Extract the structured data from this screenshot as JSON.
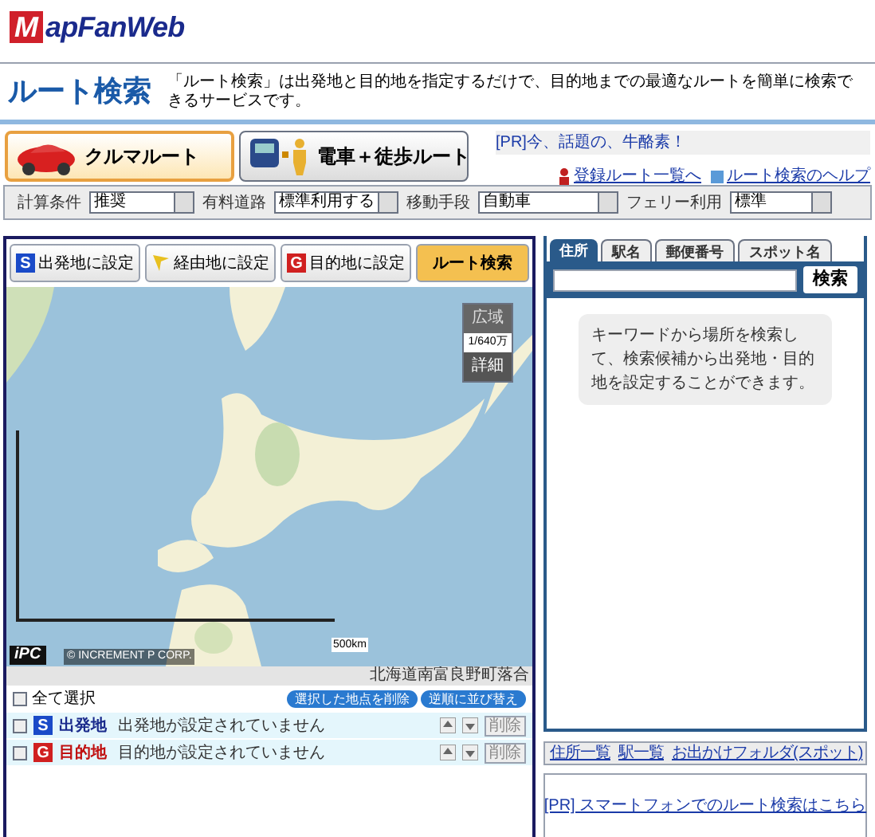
{
  "header": {
    "logo": "MapFanWeb"
  },
  "title": "ルート検索",
  "description": "「ルート検索」は出発地と目的地を指定するだけで、目的地までの最適なルートを簡単に検索できるサービスです。",
  "mode_tabs": [
    {
      "kind": "car",
      "label": "クルマルート",
      "selected": true
    },
    {
      "kind": "train",
      "label": "電車＋徒歩ルート",
      "selected": false
    }
  ],
  "pr_text": "[PR]今、話題の、牛酪素！",
  "links": [
    {
      "kind": "person",
      "label": "登録ルート一覧へ"
    },
    {
      "kind": "square",
      "label": "ルート検索のヘルプ"
    }
  ],
  "conditions": [
    {
      "label": "計算条件",
      "value": "推奨"
    },
    {
      "label": "有料道路",
      "value": "標準利用する"
    },
    {
      "label": "移動手段",
      "value": "自動車"
    },
    {
      "label": "フェリー利用",
      "value": "標準"
    }
  ],
  "map_buttons": [
    {
      "kind": "start",
      "icon": "S",
      "label": "出発地に設定"
    },
    {
      "kind": "via",
      "label": "経由地に設定"
    },
    {
      "kind": "goal",
      "icon": "G",
      "label": "目的地に設定"
    },
    {
      "kind": "search",
      "label": "ルート検索"
    }
  ],
  "map": {
    "kind": "picture",
    "zoom_out": "広域",
    "scale_ratio": "1/640万",
    "zoom_in": "詳細",
    "scale": "500km",
    "logo": "iPC",
    "copyright": "© INCREMENT P CORP.",
    "address": "北海道南富良野町落合"
  },
  "select_all": {
    "label": "全て選択",
    "checked": false
  },
  "list_actions": [
    "選択した地点を削除",
    "逆順に並び替え"
  ],
  "waypoints": [
    {
      "kind": "start",
      "icon": "S",
      "label": "出発地",
      "text": "出発地が設定されていません",
      "checked": false,
      "delete": "削除"
    },
    {
      "kind": "goal",
      "icon": "G",
      "label": "目的地",
      "text": "目的地が設定されていません",
      "checked": false,
      "delete": "削除"
    }
  ],
  "search_tabs": [
    {
      "label": "住所",
      "selected": true
    },
    {
      "label": "駅名",
      "selected": false
    },
    {
      "label": "郵便番号",
      "selected": false
    },
    {
      "label": "スポット名",
      "selected": false
    }
  ],
  "search_button": "検索",
  "search_hint": "キーワードから場所を検索して、検索候補から出発地・目的地を設定することができます。",
  "bottom_links": [
    "住所一覧",
    "駅一覧",
    "お出かけフォルダ(スポット)"
  ],
  "pr_link": "[PR] スマートフォンでのルート検索はこちら"
}
